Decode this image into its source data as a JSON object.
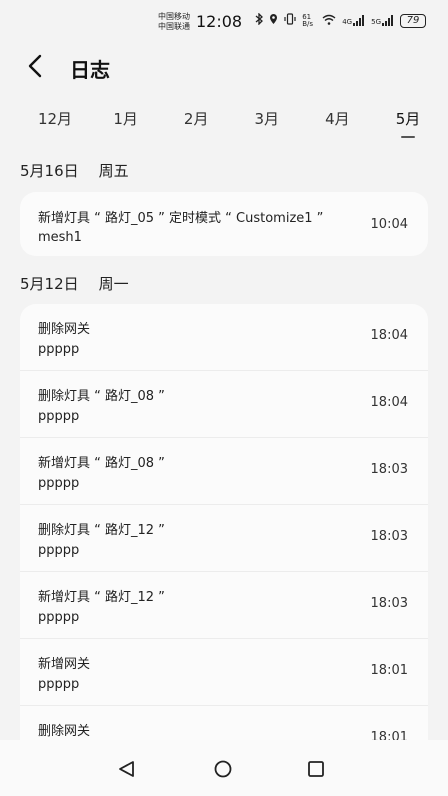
{
  "status_bar": {
    "carrier_1": "中国移动",
    "carrier_2": "中国联通",
    "time": "12:08",
    "net_speed": "61 B/s",
    "signal_1": "4G",
    "signal_2": "5G",
    "battery": "79"
  },
  "header": {
    "title": "日志"
  },
  "months": [
    "12月",
    "1月",
    "2月",
    "3月",
    "4月",
    "5月"
  ],
  "active_month": "5月",
  "groups": [
    {
      "date": "5月16日",
      "weekday": "周五",
      "entries": [
        {
          "title": "新增灯具 “ 路灯_05 ” 定时模式 “ Customize1 ”",
          "subtitle": "mesh1",
          "time": "10:04"
        }
      ]
    },
    {
      "date": "5月12日",
      "weekday": "周一",
      "entries": [
        {
          "title": "删除网关",
          "subtitle": "ppppp",
          "time": "18:04"
        },
        {
          "title": "删除灯具 “ 路灯_08 ”",
          "subtitle": "ppppp",
          "time": "18:04"
        },
        {
          "title": "新增灯具 “ 路灯_08 ”",
          "subtitle": "ppppp",
          "time": "18:03"
        },
        {
          "title": "删除灯具 “ 路灯_12 ”",
          "subtitle": "ppppp",
          "time": "18:03"
        },
        {
          "title": "新增灯具 “ 路灯_12 ”",
          "subtitle": "ppppp",
          "time": "18:03"
        },
        {
          "title": "新增网关",
          "subtitle": "ppppp",
          "time": "18:01"
        },
        {
          "title": "删除网关",
          "subtitle": "",
          "time": "18:01"
        }
      ]
    }
  ],
  "icons": {
    "back": "chevron-left-icon",
    "nav_back": "triangle-back-icon",
    "nav_home": "circle-home-icon",
    "nav_recent": "square-recent-icon"
  }
}
